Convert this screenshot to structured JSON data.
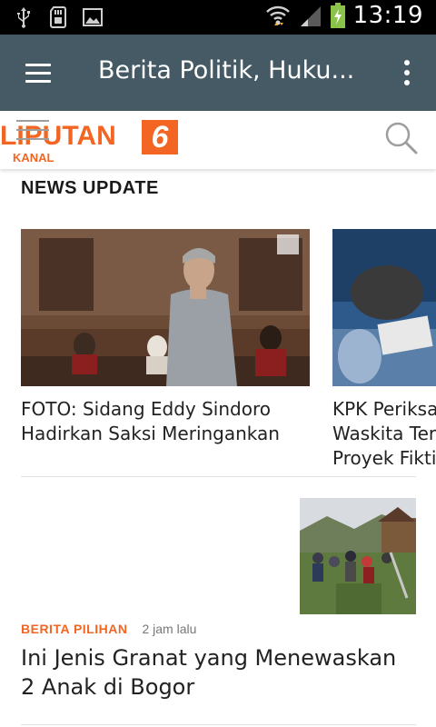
{
  "status_bar": {
    "time": "13:19",
    "icons": [
      "usb-icon",
      "sdcard-icon",
      "image-icon",
      "wifi-icon",
      "signal-icon",
      "battery-charging-icon"
    ]
  },
  "app_bar": {
    "title": "Berita Politik, Huku..."
  },
  "brand": {
    "logo_text": "LIPUTAN",
    "logo_number": "6",
    "logo_subtext": "KANAL",
    "accent_color": "#f26522"
  },
  "news_update": {
    "heading": "NEWS UPDATE",
    "cards": [
      {
        "title": "FOTO: Sidang Eddy Sindoro Hadirkan Saksi Meringankan"
      },
      {
        "title": "KPK Periksa\nWaskita Terk\nProyek Fiktif"
      }
    ]
  },
  "article": {
    "category": "BERITA PILIHAN",
    "time": "2 jam lalu",
    "title": "Ini Jenis Granat yang Menewaskan 2 Anak di Bogor"
  },
  "colors": {
    "app_bar": "#455a64",
    "status_bar": "#000000",
    "battery": "#8bc34a"
  }
}
